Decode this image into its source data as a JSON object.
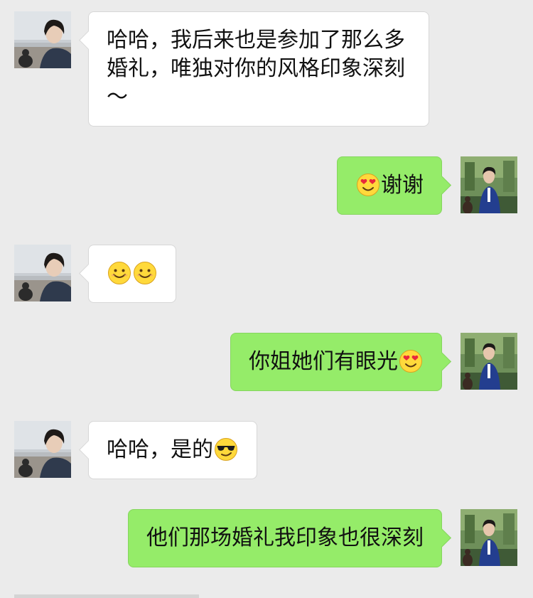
{
  "colors": {
    "background": "#ebebeb",
    "incoming_bubble": "#ffffff",
    "outgoing_bubble": "#95ec69"
  },
  "messages": [
    {
      "sender": "contact",
      "text": "哈哈，我后来也是参加了那么多婚礼，唯独对你的风格印象深刻～"
    },
    {
      "sender": "me",
      "leading_emoji": "heart-eyes-emoji",
      "text": "谢谢"
    },
    {
      "sender": "contact",
      "emojis": [
        "smile-emoji",
        "smile-emoji"
      ]
    },
    {
      "sender": "me",
      "text": "你姐她们有眼光",
      "trailing_emoji": "heart-eyes-emoji"
    },
    {
      "sender": "contact",
      "text": "哈哈，是的",
      "trailing_emoji": "sunglasses-emoji"
    },
    {
      "sender": "me",
      "text": "他们那场婚礼我印象也很深刻"
    }
  ]
}
